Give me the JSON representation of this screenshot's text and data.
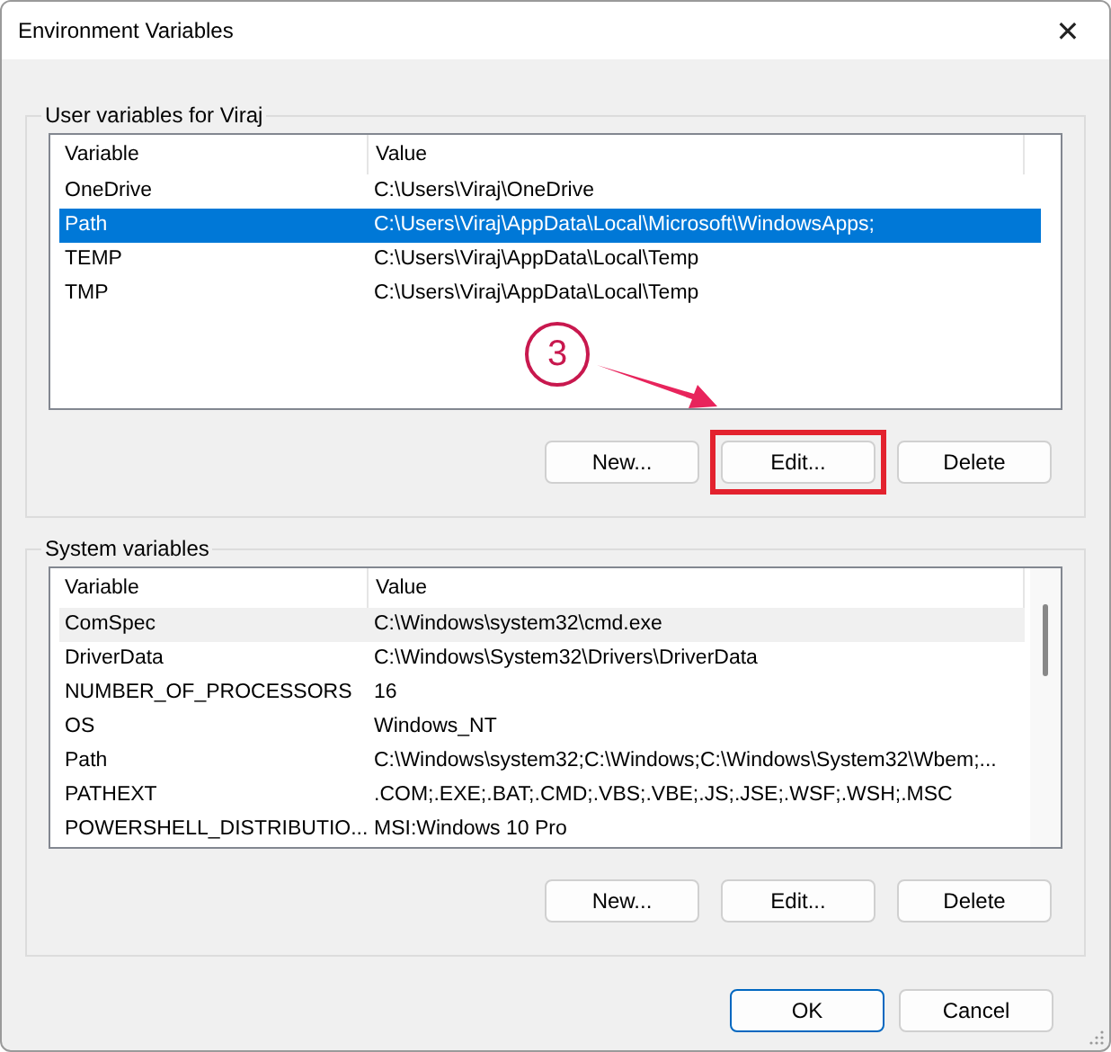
{
  "window": {
    "title": "Environment Variables",
    "close": "✕"
  },
  "groups": [
    {
      "title": "User variables for Viraj",
      "columns": [
        "Variable",
        "Value"
      ],
      "focused": true,
      "scrollbar": false,
      "rows": [
        {
          "variable": "OneDrive",
          "value": "C:\\Users\\Viraj\\OneDrive",
          "selected": false
        },
        {
          "variable": "Path",
          "value": "C:\\Users\\Viraj\\AppData\\Local\\Microsoft\\WindowsApps;",
          "selected": true
        },
        {
          "variable": "TEMP",
          "value": "C:\\Users\\Viraj\\AppData\\Local\\Temp",
          "selected": false
        },
        {
          "variable": "TMP",
          "value": "C:\\Users\\Viraj\\AppData\\Local\\Temp",
          "selected": false
        }
      ],
      "buttons": [
        {
          "label": "New...",
          "highlighted": false
        },
        {
          "label": "Edit...",
          "highlighted": true
        },
        {
          "label": "Delete",
          "highlighted": false
        }
      ],
      "annotation": {
        "step": "3"
      }
    },
    {
      "title": "System variables",
      "columns": [
        "Variable",
        "Value"
      ],
      "focused": false,
      "scrollbar": true,
      "rows": [
        {
          "variable": "ComSpec",
          "value": "C:\\Windows\\system32\\cmd.exe",
          "selected": true
        },
        {
          "variable": "DriverData",
          "value": "C:\\Windows\\System32\\Drivers\\DriverData",
          "selected": false
        },
        {
          "variable": "NUMBER_OF_PROCESSORS",
          "value": "16",
          "selected": false
        },
        {
          "variable": "OS",
          "value": "Windows_NT",
          "selected": false
        },
        {
          "variable": "Path",
          "value": "C:\\Windows\\system32;C:\\Windows;C:\\Windows\\System32\\Wbem;...",
          "selected": false
        },
        {
          "variable": "PATHEXT",
          "value": ".COM;.EXE;.BAT;.CMD;.VBS;.VBE;.JS;.JSE;.WSF;.WSH;.MSC",
          "selected": false
        },
        {
          "variable": "POWERSHELL_DISTRIBUTIO...",
          "value": "MSI:Windows 10 Pro",
          "selected": false
        }
      ],
      "buttons": [
        {
          "label": "New...",
          "highlighted": false
        },
        {
          "label": "Edit...",
          "highlighted": false
        },
        {
          "label": "Delete",
          "highlighted": false
        }
      ]
    }
  ],
  "footer": {
    "buttons": [
      {
        "label": "OK",
        "default": true
      },
      {
        "label": "Cancel",
        "default": false
      }
    ]
  }
}
